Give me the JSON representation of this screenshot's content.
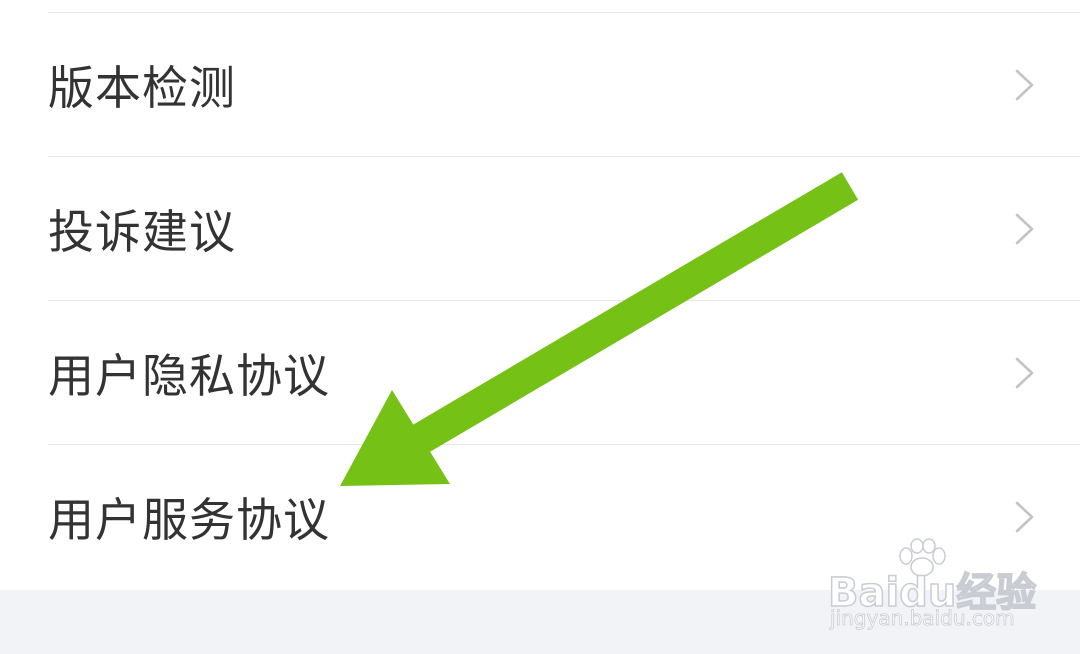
{
  "menu": {
    "items": [
      {
        "label": "版本检测",
        "icon": "chevron-right-icon"
      },
      {
        "label": "投诉建议",
        "icon": "chevron-right-icon"
      },
      {
        "label": "用户隐私协议",
        "icon": "chevron-right-icon"
      },
      {
        "label": "用户服务协议",
        "icon": "chevron-right-icon"
      }
    ]
  },
  "annotation": {
    "arrow_color": "#76c115",
    "icon": "arrow-annotation-icon"
  },
  "watermark": {
    "brand": "Baidu经验",
    "url": "jingyan.baidu.com",
    "icon": "baidu-paw-icon"
  },
  "colors": {
    "text": "#333333",
    "chevron": "#c4c4c8",
    "divider": "#e6e6e6",
    "footer_background": "#f1f3f7"
  }
}
